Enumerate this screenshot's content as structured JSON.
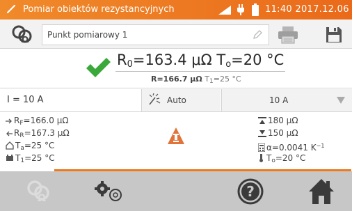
{
  "status_bar": {
    "title": "Pomiar obiektów rezystancyjnych",
    "clock": "11:40 2017.12.06"
  },
  "header": {
    "point_name": "Punkt pomiarowy 1"
  },
  "result": {
    "main_label": "R",
    "main_sub": "0",
    "main_value": "=163.4 μΩ",
    "temp_label": "T",
    "temp_sub": "o",
    "temp_value": "=20 °C",
    "secondary_r": "R=166.7 μΩ",
    "secondary_t_label": "T",
    "secondary_t_sub": "1",
    "secondary_t_value": "=25 °C"
  },
  "controls": {
    "current": "I = 10 A",
    "auto_label": "Auto",
    "range_value": "10 A"
  },
  "details": {
    "rf_label": "R",
    "rf_sub": "F",
    "rf_value": "=166.0 μΩ",
    "rr_label": "R",
    "rr_sub": "R",
    "rr_value": "=167.3 μΩ",
    "ta_label": "T",
    "ta_sub": "a",
    "ta_value": "=25 °C",
    "t1_label": "T",
    "t1_sub": "1",
    "t1_value": "=25 °C",
    "upper_limit": "180 μΩ",
    "lower_limit": "150 μΩ",
    "alpha_value": "α=0.0041 K",
    "alpha_exp": "−1",
    "to_label": "T",
    "to_sub": "o",
    "to_value": "=20 °C"
  },
  "colors": {
    "accent": "#ee7a20",
    "ok_green": "#3aa83a",
    "toolbar_bg": "#c7c7c7"
  }
}
